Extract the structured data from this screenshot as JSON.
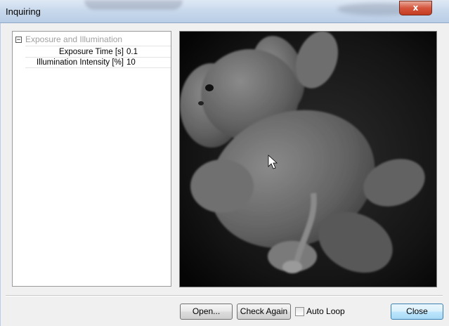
{
  "window": {
    "title": "Inquiring",
    "close_glyph": "x"
  },
  "properties": {
    "category": "Exposure and Illumination",
    "expander_glyph": "−",
    "rows": [
      {
        "name": "Exposure Time [s]",
        "value": "0.1"
      },
      {
        "name": "Illumination Intensity [%]",
        "value": "10"
      }
    ]
  },
  "preview": {
    "icon": "camera-image"
  },
  "buttons": {
    "open": "Open...",
    "check_again": "Check Again",
    "auto_loop": "Auto Loop",
    "close": "Close"
  },
  "auto_loop_checked": false
}
